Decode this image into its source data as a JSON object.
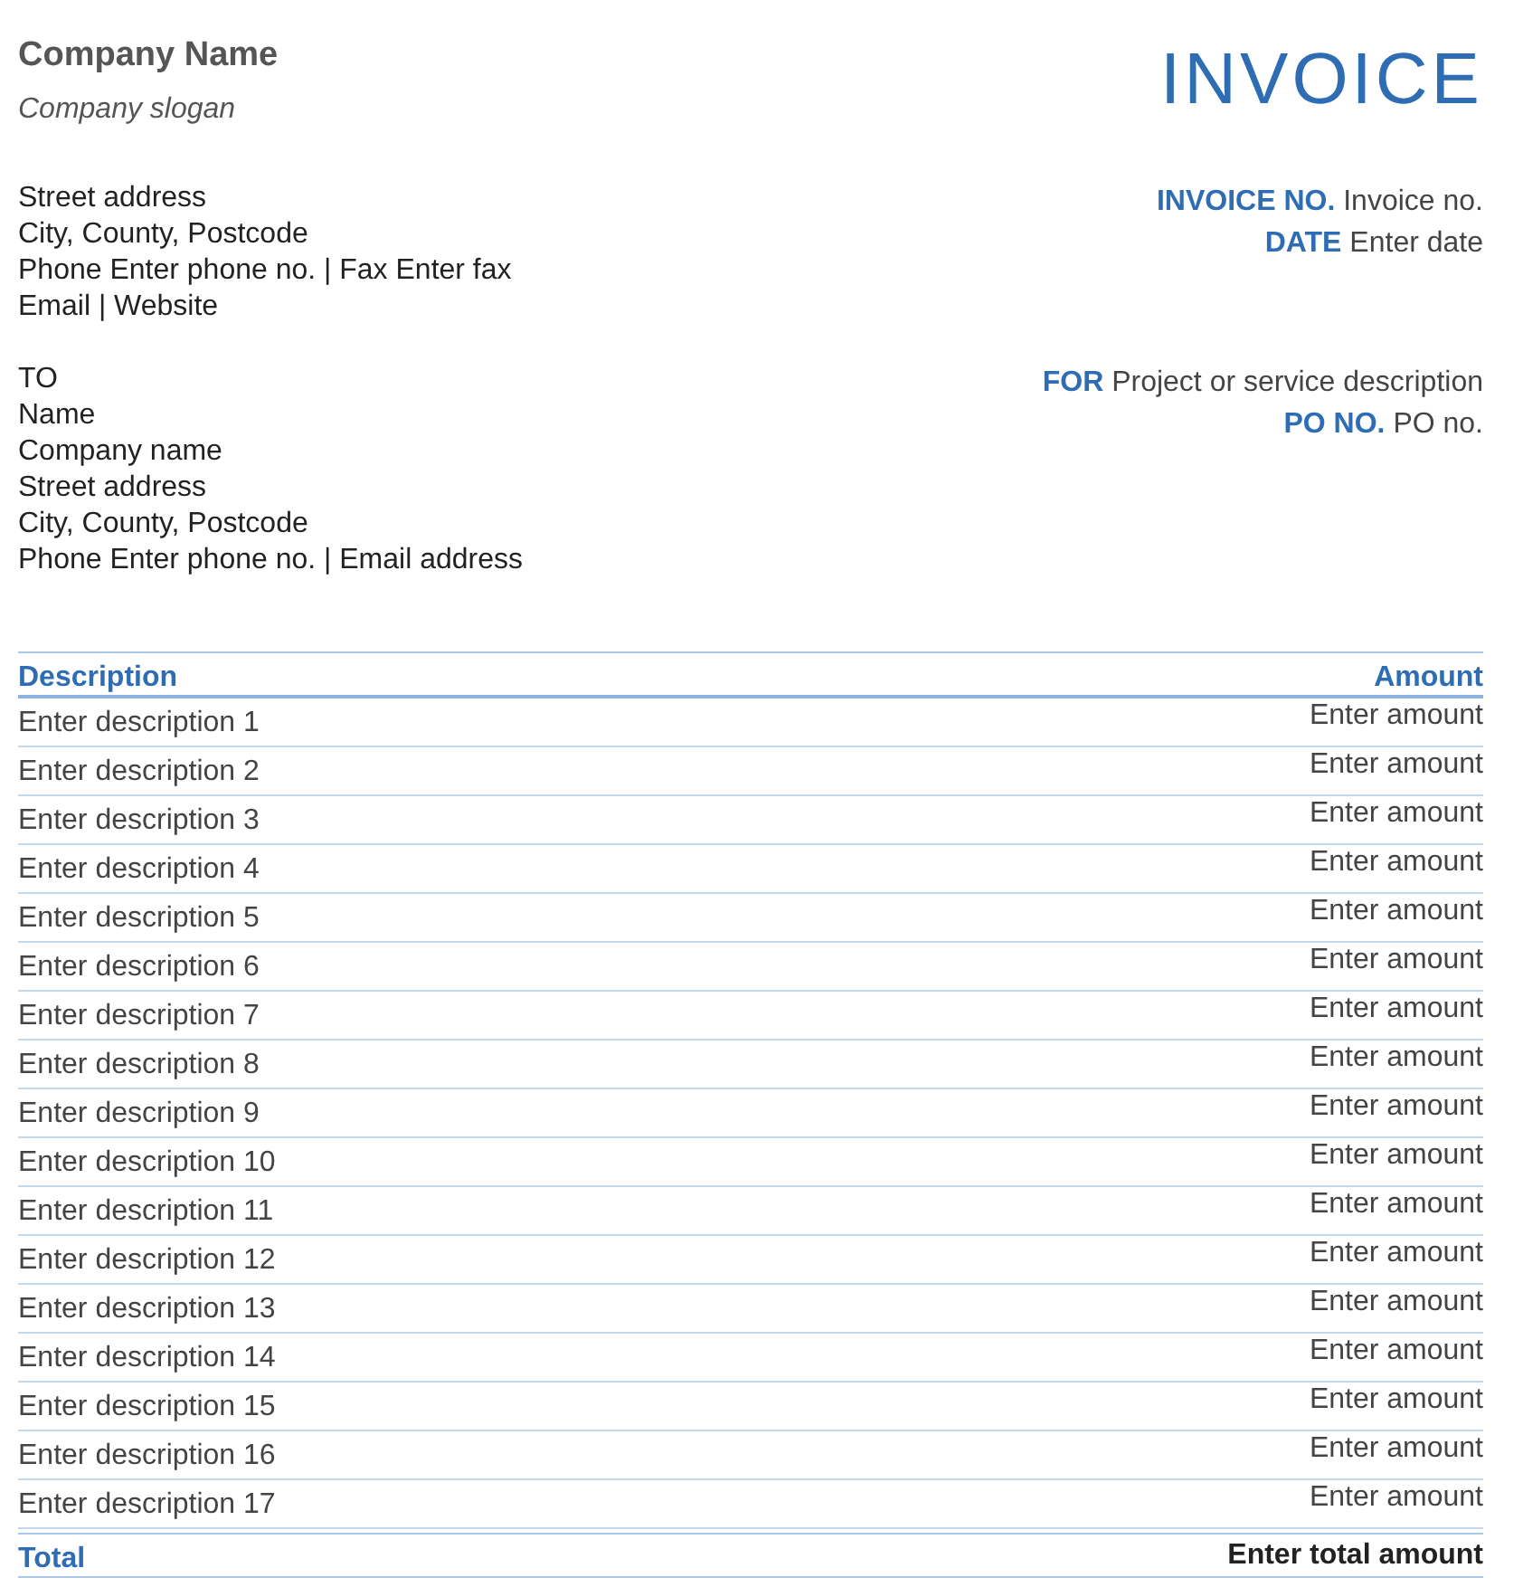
{
  "company": {
    "name": "Company Name",
    "slogan": "Company slogan"
  },
  "title": "INVOICE",
  "sender_address": [
    "Street address",
    "City, County, Postcode",
    "Phone Enter phone no. | Fax Enter fax",
    "Email | Website"
  ],
  "invoice_meta": [
    {
      "label": "INVOICE NO.",
      "value": "Invoice no."
    },
    {
      "label": "DATE",
      "value": "Enter date"
    }
  ],
  "recipient": {
    "label": "TO",
    "lines": [
      "Name",
      "Company name",
      "Street address",
      "City, County, Postcode",
      "Phone Enter phone no. | Email address"
    ]
  },
  "project_meta": [
    {
      "label": "FOR",
      "value": "Project or service description"
    },
    {
      "label": "PO NO.",
      "value": "PO no."
    }
  ],
  "table": {
    "columns": [
      "Description",
      "Amount"
    ],
    "rows": [
      {
        "description": "Enter description 1",
        "amount": "Enter amount"
      },
      {
        "description": "Enter description 2",
        "amount": "Enter amount"
      },
      {
        "description": "Enter description 3",
        "amount": "Enter amount"
      },
      {
        "description": "Enter description 4",
        "amount": "Enter amount"
      },
      {
        "description": "Enter description 5",
        "amount": "Enter amount"
      },
      {
        "description": "Enter description 6",
        "amount": "Enter amount"
      },
      {
        "description": "Enter description 7",
        "amount": "Enter amount"
      },
      {
        "description": "Enter description 8",
        "amount": "Enter amount"
      },
      {
        "description": "Enter description 9",
        "amount": "Enter amount"
      },
      {
        "description": "Enter description 10",
        "amount": "Enter amount"
      },
      {
        "description": "Enter description 11",
        "amount": "Enter amount"
      },
      {
        "description": "Enter description 12",
        "amount": "Enter amount"
      },
      {
        "description": "Enter description 13",
        "amount": "Enter amount"
      },
      {
        "description": "Enter description 14",
        "amount": "Enter amount"
      },
      {
        "description": "Enter description 15",
        "amount": "Enter amount"
      },
      {
        "description": "Enter description 16",
        "amount": "Enter amount"
      },
      {
        "description": "Enter description 17",
        "amount": "Enter amount"
      }
    ],
    "total": {
      "label": "Total",
      "value": "Enter total amount"
    }
  }
}
